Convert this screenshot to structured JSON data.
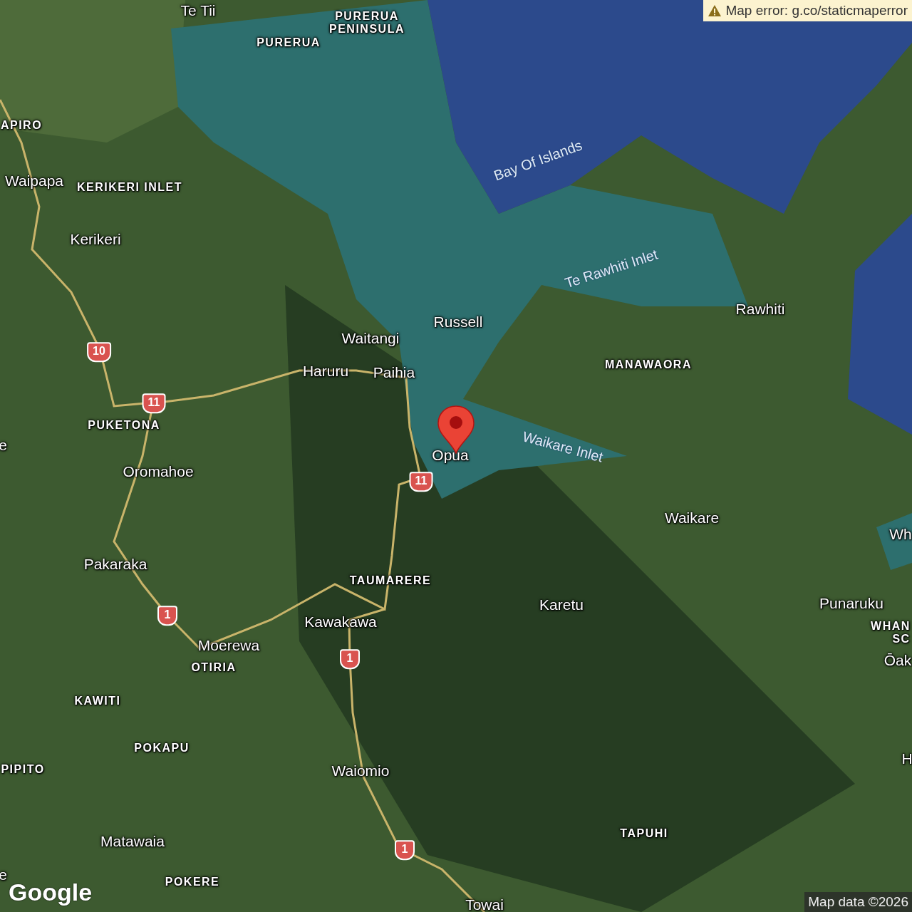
{
  "map": {
    "labels": [
      {
        "text": "Te Tii",
        "kind": "place"
      },
      {
        "text": "PURERUA PENINSULA",
        "kind": "locality"
      },
      {
        "text": "PURERUA",
        "kind": "locality"
      },
      {
        "text": "APIRO",
        "kind": "locality"
      },
      {
        "text": "Waipapa",
        "kind": "place"
      },
      {
        "text": "KERIKERI INLET",
        "kind": "locality"
      },
      {
        "text": "Kerikeri",
        "kind": "place"
      },
      {
        "text": "Bay Of Islands",
        "kind": "water"
      },
      {
        "text": "Te Rawhiti Inlet",
        "kind": "water"
      },
      {
        "text": "Russell",
        "kind": "place"
      },
      {
        "text": "Waitangi",
        "kind": "place"
      },
      {
        "text": "Rawhiti",
        "kind": "place"
      },
      {
        "text": "Haruru",
        "kind": "place"
      },
      {
        "text": "Paihia",
        "kind": "place"
      },
      {
        "text": "MANAWAORA",
        "kind": "locality"
      },
      {
        "text": "PUKETONA",
        "kind": "locality"
      },
      {
        "text": "Opua",
        "kind": "place"
      },
      {
        "text": "Waikare Inlet",
        "kind": "water"
      },
      {
        "text": "Oromahoe",
        "kind": "place"
      },
      {
        "text": "e",
        "kind": "place"
      },
      {
        "text": "Waikare",
        "kind": "place"
      },
      {
        "text": "Wh",
        "kind": "place"
      },
      {
        "text": "Pakaraka",
        "kind": "place"
      },
      {
        "text": "TAUMARERE",
        "kind": "locality"
      },
      {
        "text": "Karetu",
        "kind": "place"
      },
      {
        "text": "Punaruku",
        "kind": "place"
      },
      {
        "text": "Kawakawa",
        "kind": "place"
      },
      {
        "text": "WHAN",
        "kind": "locality"
      },
      {
        "text": "SC",
        "kind": "locality"
      },
      {
        "text": "Moerewa",
        "kind": "place"
      },
      {
        "text": "OTIRIA",
        "kind": "locality"
      },
      {
        "text": "Ōak",
        "kind": "place"
      },
      {
        "text": "KAWITI",
        "kind": "locality"
      },
      {
        "text": "POKAPU",
        "kind": "locality"
      },
      {
        "text": "H",
        "kind": "place"
      },
      {
        "text": "PIPITO",
        "kind": "locality"
      },
      {
        "text": "Waiomio",
        "kind": "place"
      },
      {
        "text": "Matawaia",
        "kind": "place"
      },
      {
        "text": "TAPUHI",
        "kind": "locality"
      },
      {
        "text": "e",
        "kind": "place"
      },
      {
        "text": "POKERE",
        "kind": "locality"
      },
      {
        "text": "Towai",
        "kind": "place"
      }
    ],
    "road_shields": [
      {
        "text": "10"
      },
      {
        "text": "11"
      },
      {
        "text": "11"
      },
      {
        "text": "1"
      },
      {
        "text": "1"
      },
      {
        "text": "1"
      }
    ]
  },
  "error_banner": {
    "text": "Map error: g.co/staticmaperror"
  },
  "logo": {
    "text": "Google"
  },
  "attribution": {
    "text": "Map data ©2026"
  }
}
